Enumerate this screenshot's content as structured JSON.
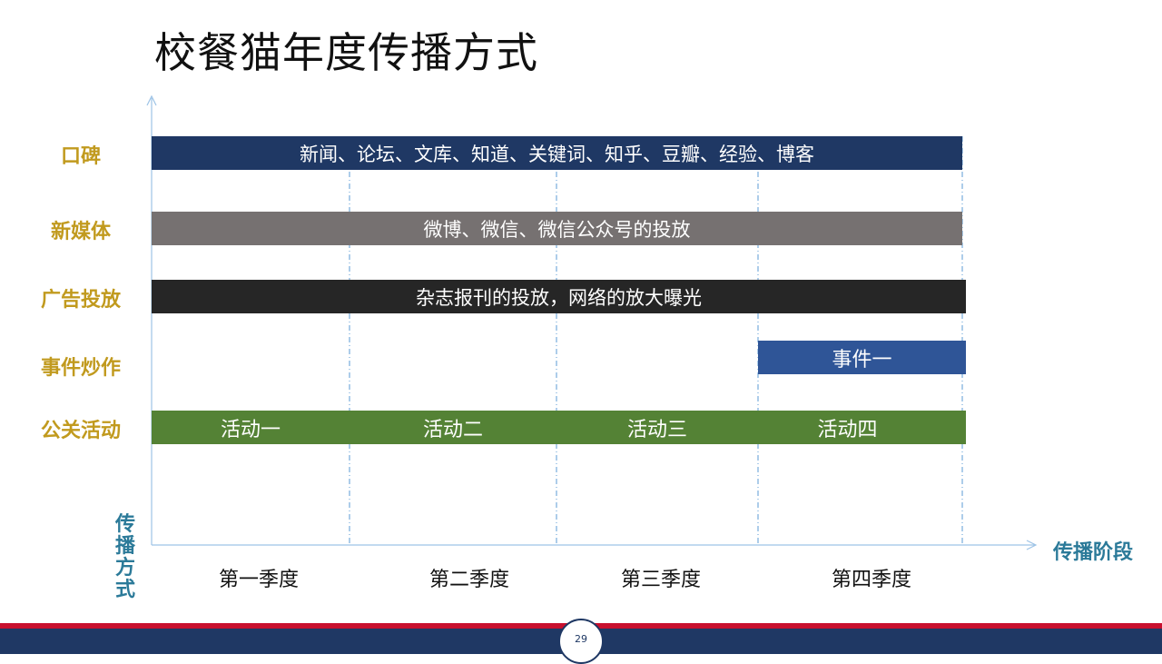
{
  "title": "校餐猫年度传播方式",
  "axes": {
    "x_title": "传播阶段",
    "y_title": "传播方式"
  },
  "quarters": [
    "第一季度",
    "第二季度",
    "第三季度",
    "第四季度"
  ],
  "rows": [
    {
      "label": "口碑",
      "bar_text": "新闻、论坛、文库、知道、关键词、知乎、豆瓣、经验、博客",
      "color": "#1f3864"
    },
    {
      "label": "新媒体",
      "bar_text": "微博、微信、微信公众号的投放",
      "color": "#767171"
    },
    {
      "label": "广告投放",
      "bar_text": "杂志报刊的投放，网络的放大曝光",
      "color": "#262626"
    },
    {
      "label": "事件炒作",
      "bar_text": "事件一",
      "color": "#2f5597"
    },
    {
      "label": "公关活动",
      "segments": [
        "活动一",
        "活动二",
        "活动三",
        "活动四"
      ],
      "color": "#548235"
    }
  ],
  "footer": {
    "page_number": "29",
    "accent_red": "#c8102e",
    "accent_navy": "#1f3864"
  }
}
